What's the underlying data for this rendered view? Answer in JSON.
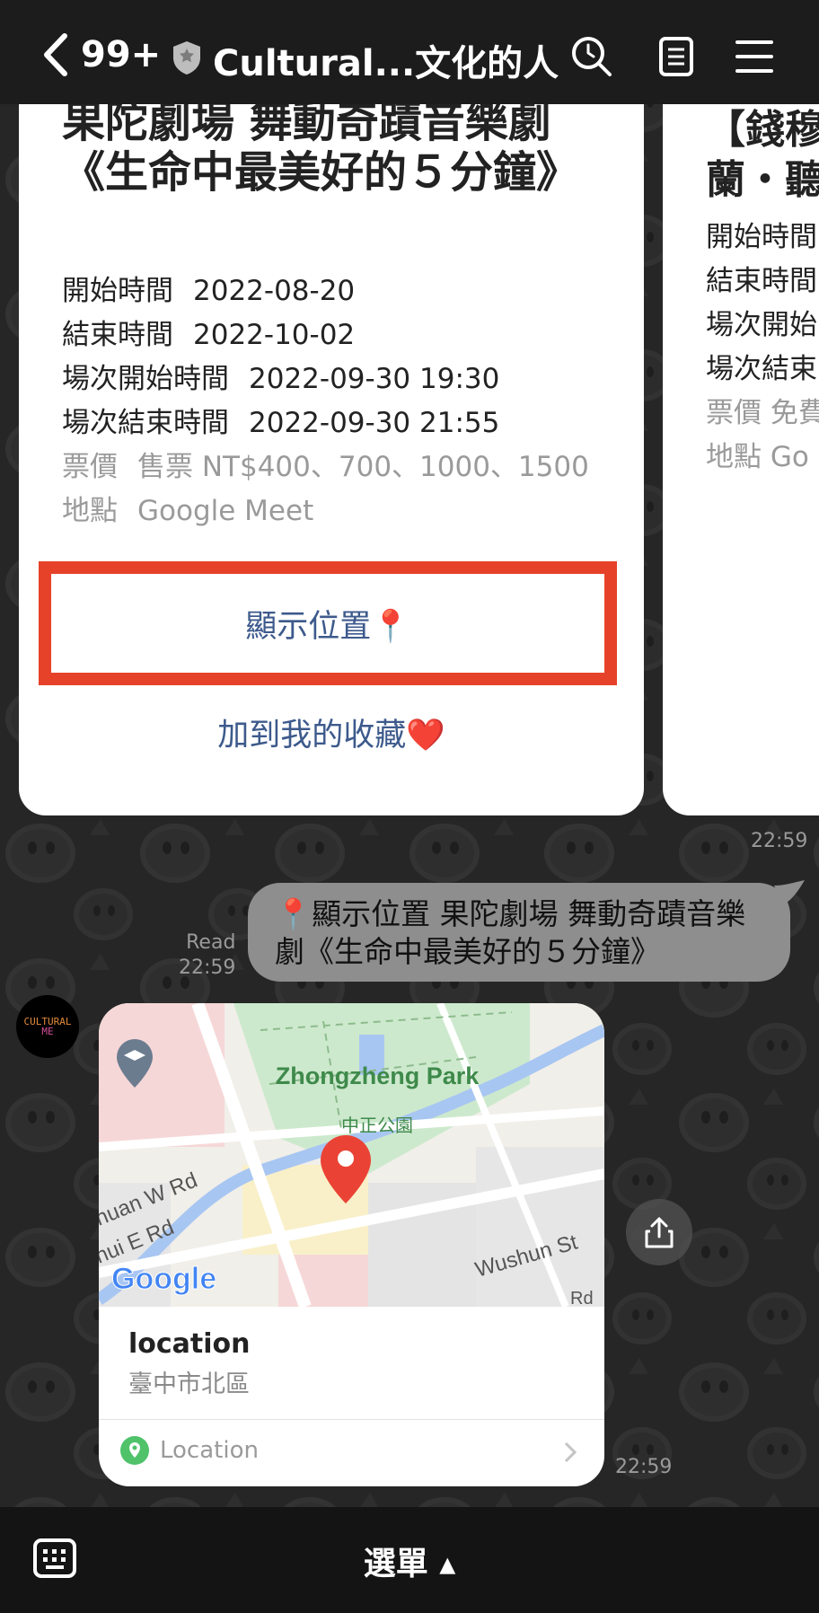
{
  "header": {
    "unread_count": "99+",
    "chat_title": "Cultural...文化的人"
  },
  "card": {
    "title": "果陀劇場  舞動奇蹟音樂劇《生命中最美好的５分鐘》",
    "rows": [
      {
        "label": "開始時間",
        "value": "2022-08-20"
      },
      {
        "label": "結束時間",
        "value": "2022-10-02"
      },
      {
        "label": "場次開始時間",
        "value": "2022-09-30 19:30"
      },
      {
        "label": "場次結束時間",
        "value": "2022-09-30 21:55"
      }
    ],
    "price": {
      "label": "票價",
      "value": "售票  NT$400、700、1000、1500"
    },
    "place": {
      "label": "地點",
      "value": "Google Meet"
    },
    "show_location_button": "顯示位置📍",
    "add_favorite_button": "加到我的收藏❤️"
  },
  "card2": {
    "title_line1": "【錢穆",
    "title_line2": "蘭・聽",
    "rows": [
      "開始時間",
      "結束時間",
      "場次開始",
      "場次結束"
    ],
    "price": "票價  免費",
    "place": "地點  Go"
  },
  "messages": {
    "card_time": "22:59",
    "bubble_text": "📍顯示位置 果陀劇場  舞動奇蹟音樂劇《生命中最美好的５分鐘》",
    "read_label": "Read",
    "read_time": "22:59",
    "map_time": "22:59"
  },
  "avatar": {
    "line1": "CULTURAL",
    "line2": "ME"
  },
  "map": {
    "park_label_en": "Zhongzheng Park",
    "park_label_zh": "中正公園",
    "road1": "huan W Rd",
    "road2": "hui E Rd",
    "road3": "Wushun St",
    "road4": "Rd",
    "google_logo": "Google"
  },
  "location_card": {
    "title": "location",
    "subtitle": "臺中市北區",
    "footer": "Location"
  },
  "bottom": {
    "menu_label": "選單 ▴"
  }
}
